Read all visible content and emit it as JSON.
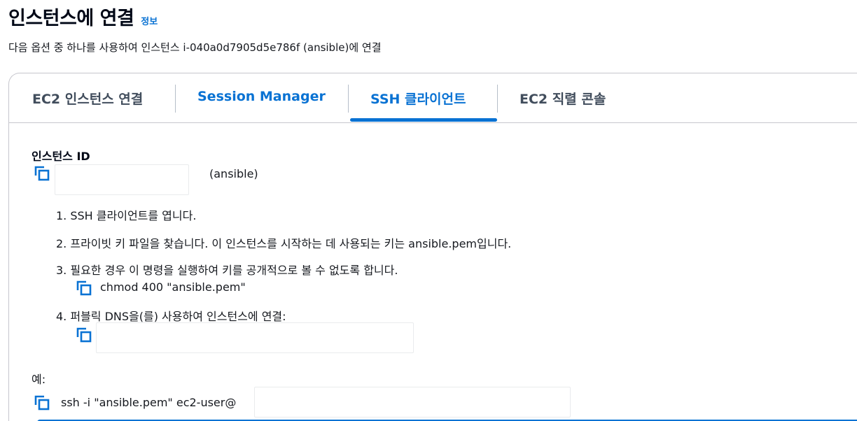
{
  "header": {
    "title": "인스턴스에 연결",
    "info_link": "정보",
    "subtitle": "다음 옵션 중 하나를 사용하여 인스턴스 i-040a0d7905d5e786f (ansible)에 연결"
  },
  "tabs": [
    {
      "label": "EC2 인스턴스 연결"
    },
    {
      "label": "Session Manager"
    },
    {
      "label": "SSH 클라이언트"
    },
    {
      "label": "EC2 직렬 콘솔"
    }
  ],
  "instance": {
    "label": "인스턴스 ID",
    "name_suffix": "(ansible)"
  },
  "steps": [
    "1. SSH 클라이언트를 엽니다.",
    "2. 프라이빗 키 파일을 찾습니다. 이 인스턴스를 시작하는 데 사용되는 키는 ansible.pem입니다.",
    "3. 필요한 경우 이 명령을 실행하여 키를 공개적으로 볼 수 없도록 합니다.",
    "4. 퍼블릭 DNS을(를) 사용하여 인스턴스에 연결:"
  ],
  "chmod_command": "chmod 400 \"ansible.pem\"",
  "example": {
    "label": "예:",
    "command": "ssh -i \"ansible.pem\" ec2-user@"
  },
  "icons": {
    "copy": "copy-icon"
  },
  "colors": {
    "accent": "#0972d3",
    "text": "#16191f",
    "tab_default": "#414d5c",
    "border": "#c6c6cd"
  }
}
